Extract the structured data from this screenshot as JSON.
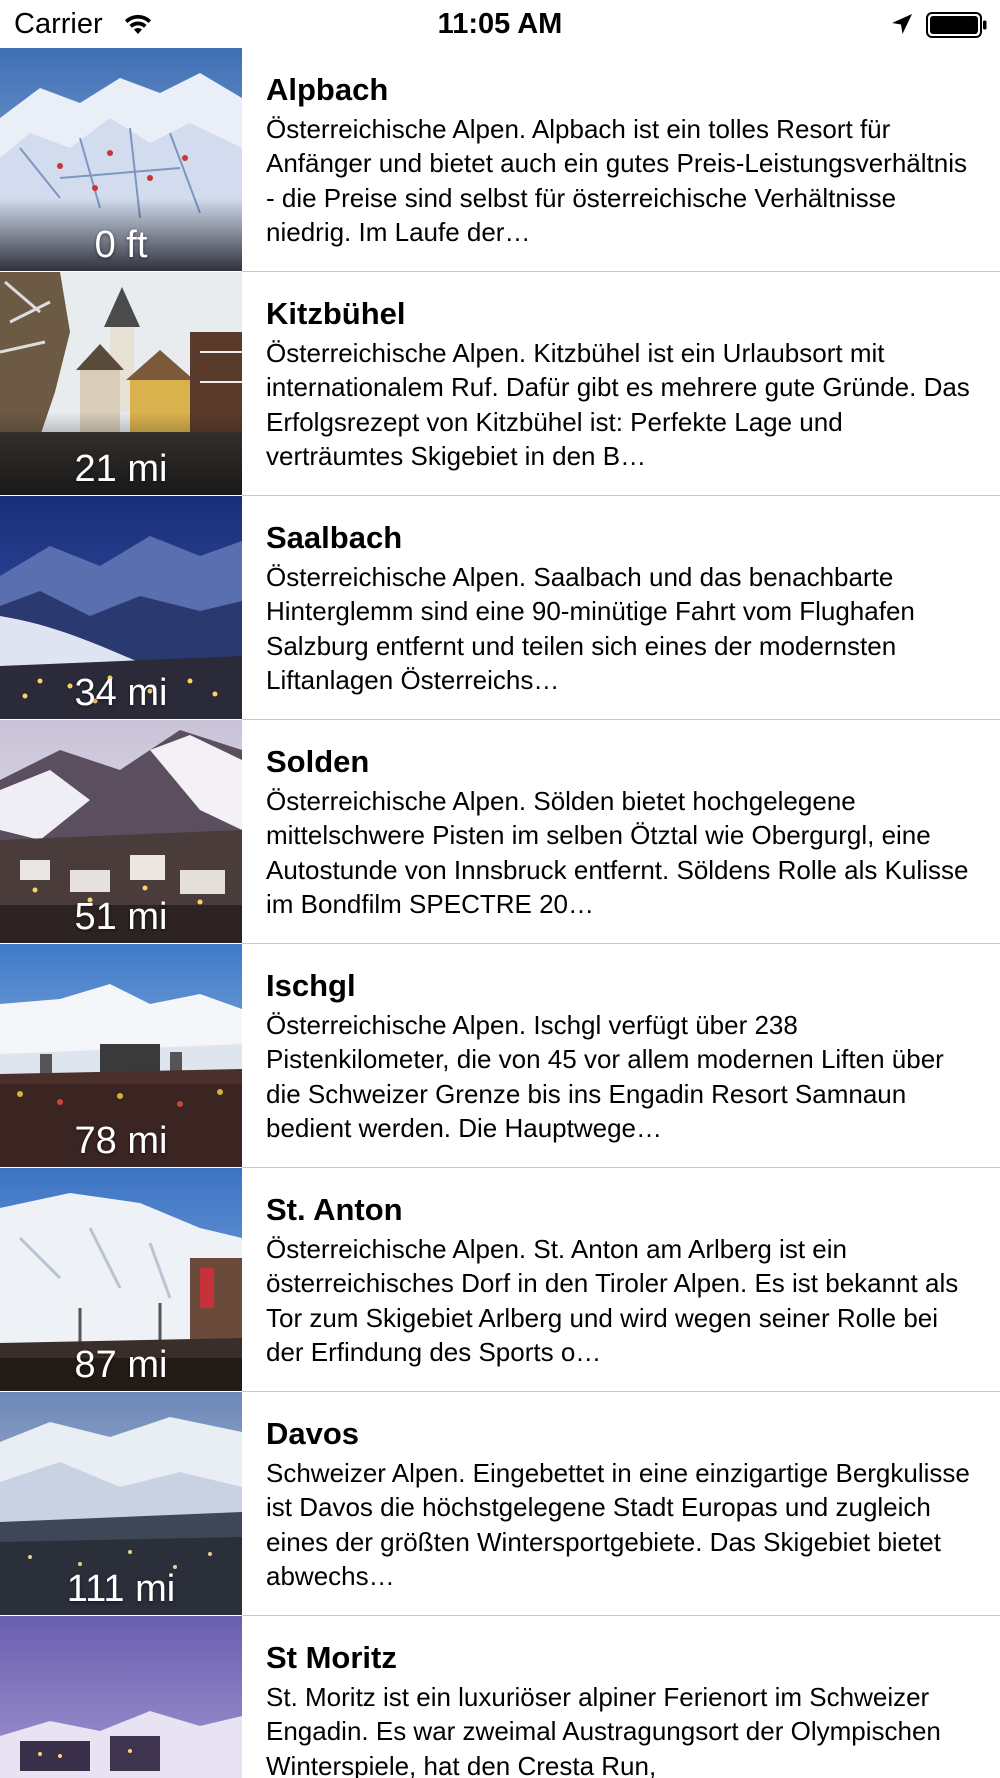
{
  "status_bar": {
    "carrier": "Carrier",
    "time": "11:05 AM",
    "icons": [
      "wifi-icon",
      "location-arrow-icon",
      "battery-icon"
    ]
  },
  "resorts": [
    {
      "name": "Alpbach",
      "distance": "0 ft",
      "description": "Österreichische Alpen. Alpbach ist ein tolles Resort für Anfänger und bietet auch ein gutes Preis-Leistungsverhältnis - die Preise sind selbst für österreichische Verhältnisse niedrig. Im Laufe der…"
    },
    {
      "name": "Kitzbühel",
      "distance": "21 mi",
      "description": "Österreichische Alpen. Kitzbühel ist ein Urlaubsort mit internationalem Ruf. Dafür gibt es mehrere gute Gründe. Das Erfolgsrezept von Kitzbühel ist: Perfekte Lage und verträumtes Skigebiet in den B…"
    },
    {
      "name": "Saalbach",
      "distance": "34 mi",
      "description": "Österreichische Alpen. Saalbach und das benachbarte Hinterglemm sind eine 90-minütige Fahrt vom Flughafen Salzburg entfernt und teilen sich eines der modernsten Liftanlagen Österreichs…"
    },
    {
      "name": "Solden",
      "distance": "51 mi",
      "description": "Österreichische Alpen. Sölden bietet hochgelegene mittelschwere Pisten im selben Ötztal wie Obergurgl, eine Autostunde von Innsbruck entfernt. Söldens Rolle als Kulisse im Bondfilm SPECTRE 20…"
    },
    {
      "name": "Ischgl",
      "distance": "78 mi",
      "description": "Österreichische Alpen. Ischgl verfügt über 238 Pistenkilometer, die von 45 vor allem modernen Liften über die Schweizer Grenze bis ins Engadin Resort Samnaun bedient werden. Die Hauptwege…"
    },
    {
      "name": "St. Anton",
      "distance": "87 mi",
      "description": "Österreichische Alpen. St. Anton am Arlberg ist ein österreichisches Dorf in den Tiroler Alpen. Es ist bekannt als Tor zum Skigebiet Arlberg und wird wegen seiner Rolle bei der Erfindung des Sports o…"
    },
    {
      "name": "Davos",
      "distance": "111 mi",
      "description": "Schweizer Alpen. Eingebettet in eine einzigartige Bergkulisse ist Davos die höchstgelegene Stadt Europas und zugleich eines der größten Wintersportgebiete. Das Skigebiet bietet abwechs…"
    },
    {
      "name": "St Moritz",
      "distance": "",
      "description": "St. Moritz ist ein luxuriöser alpiner Ferienort im Schweizer Engadin. Es war zweimal Austragungsort der Olympischen Winterspiele, hat den Cresta Run,"
    }
  ]
}
